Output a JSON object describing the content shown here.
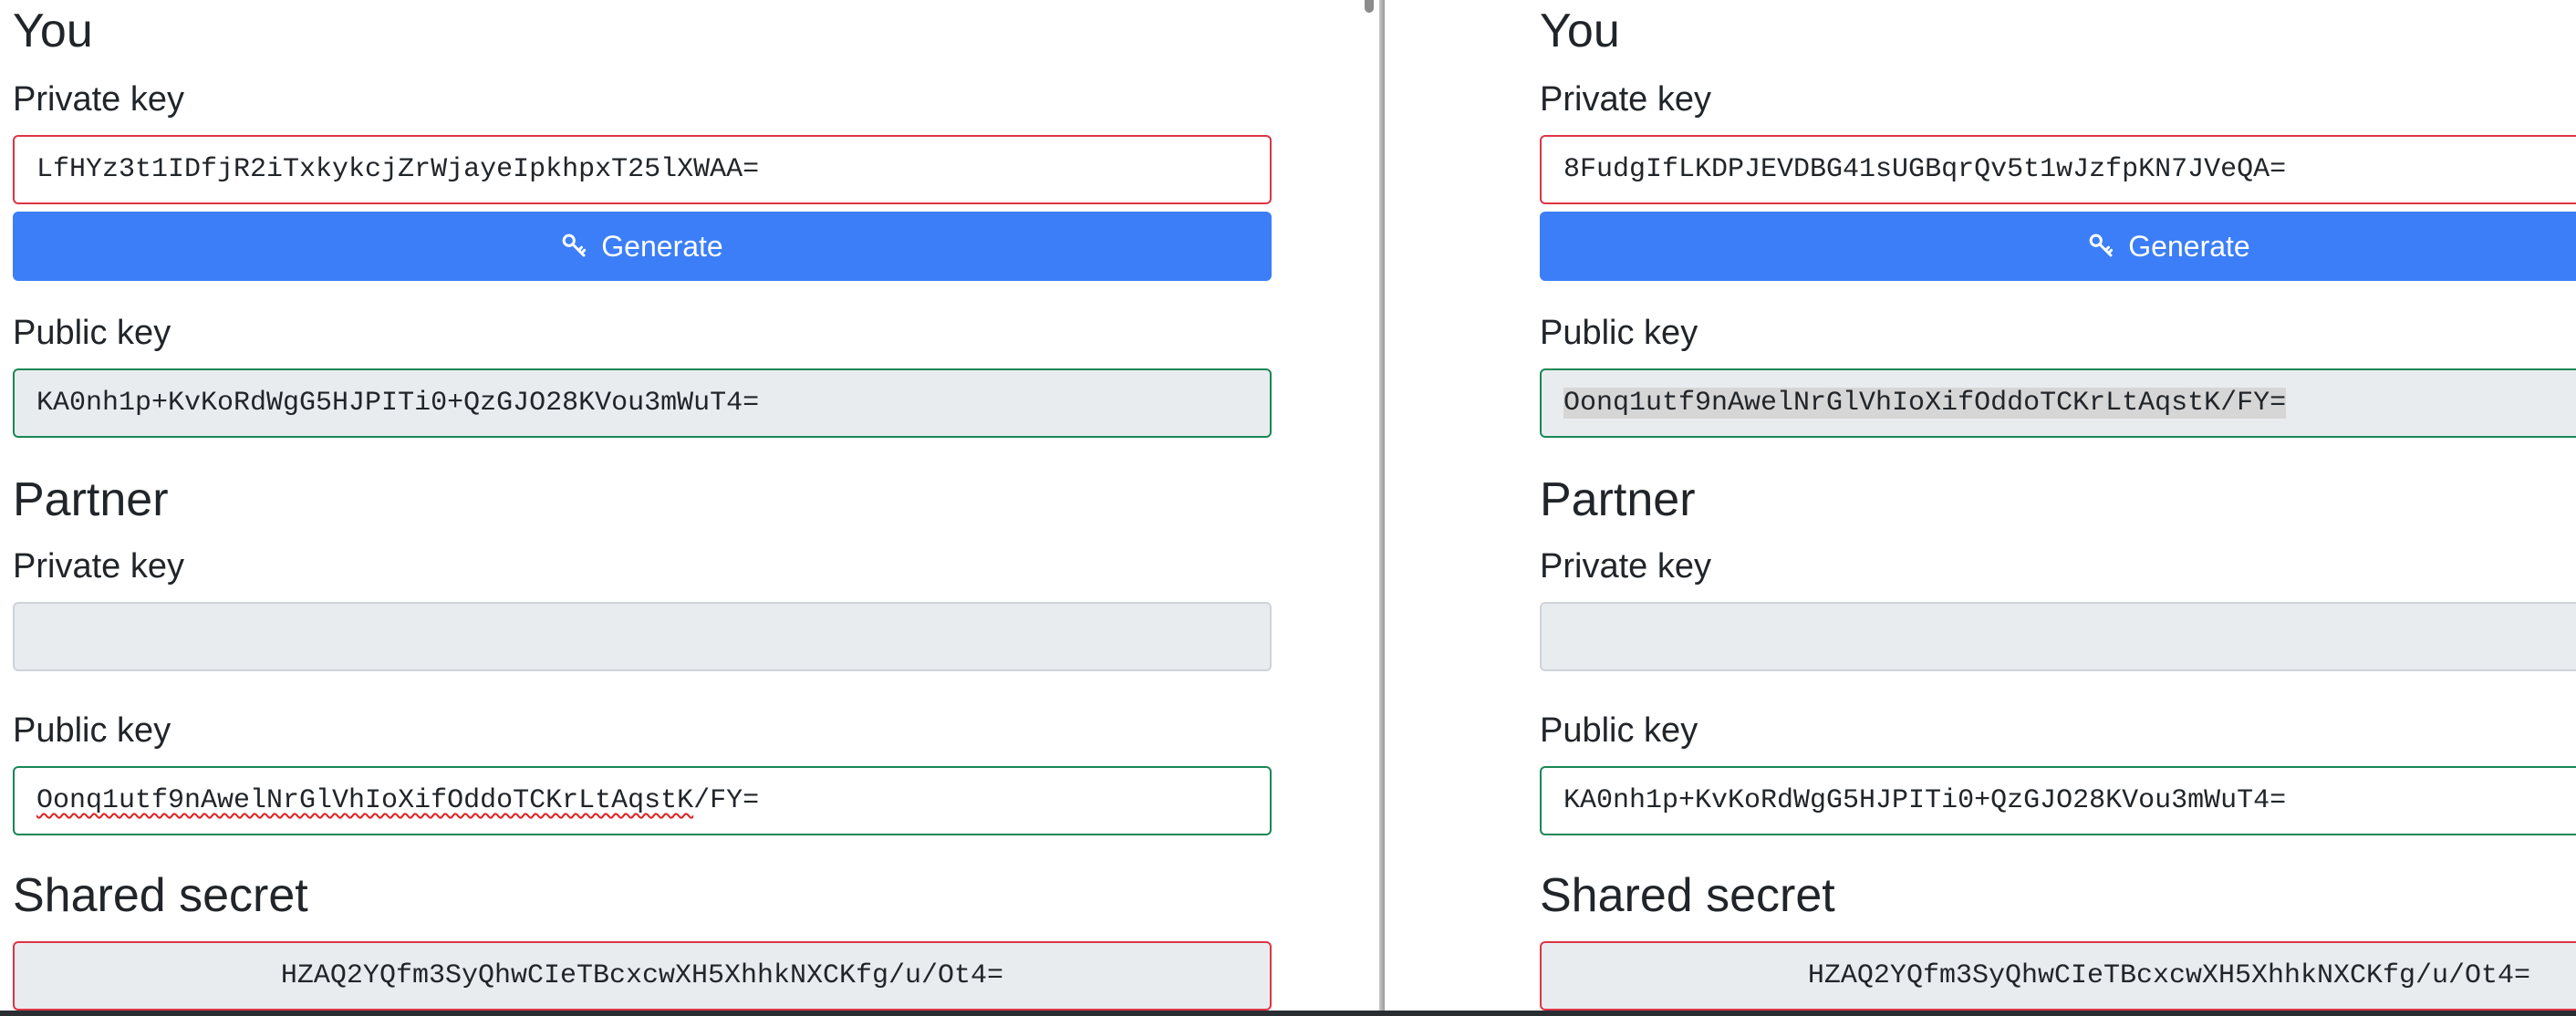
{
  "left": {
    "you": {
      "title": "You",
      "private_key_label": "Private key",
      "private_key": "LfHYz3t1IDfjR2iTxkykcjZrWjayeIpkhpxT25lXWAA=",
      "generate_label": "Generate",
      "public_key_label": "Public key",
      "public_key": "KA0nh1p+KvKoRdWgG5HJPITi0+QzGJO28KVou3mWuT4="
    },
    "partner": {
      "title": "Partner",
      "private_key_label": "Private key",
      "private_key": "",
      "public_key_label": "Public key",
      "public_key_misspelled": "Oonq1utf9nAwelNrGlVhIoXifOddoTCKrLtAqstK",
      "public_key_rest": "/FY="
    },
    "shared": {
      "title": "Shared secret",
      "value": "HZAQ2YQfm3SyQhwCIeTBcxcwXH5XhhkNXCKfg/u/Ot4="
    }
  },
  "right": {
    "you": {
      "title": "You",
      "private_key_label": "Private key",
      "private_key": "8FudgIfLKDPJEVDBG41sUGBqrQv5t1wJzfpKN7JVeQA=",
      "generate_label": "Generate",
      "public_key_label": "Public key",
      "public_key": "Oonq1utf9nAwelNrGlVhIoXifOddoTCKrLtAqstK/FY="
    },
    "partner": {
      "title": "Partner",
      "private_key_label": "Private key",
      "private_key": "",
      "public_key_label": "Public key",
      "public_key": "KA0nh1p+KvKoRdWgG5HJPITi0+QzGJO28KVou3mWuT4="
    },
    "shared": {
      "title": "Shared secret",
      "value": "HZAQ2YQfm3SyQhwCIeTBcxcwXH5XhhkNXCKfg/u/Ot4="
    }
  },
  "icons": {
    "generate": "key-icon"
  },
  "colors": {
    "primary": "#3b7ef8",
    "invalid": "#dc3545",
    "valid": "#198754",
    "readonly_bg": "#e9ecef"
  }
}
